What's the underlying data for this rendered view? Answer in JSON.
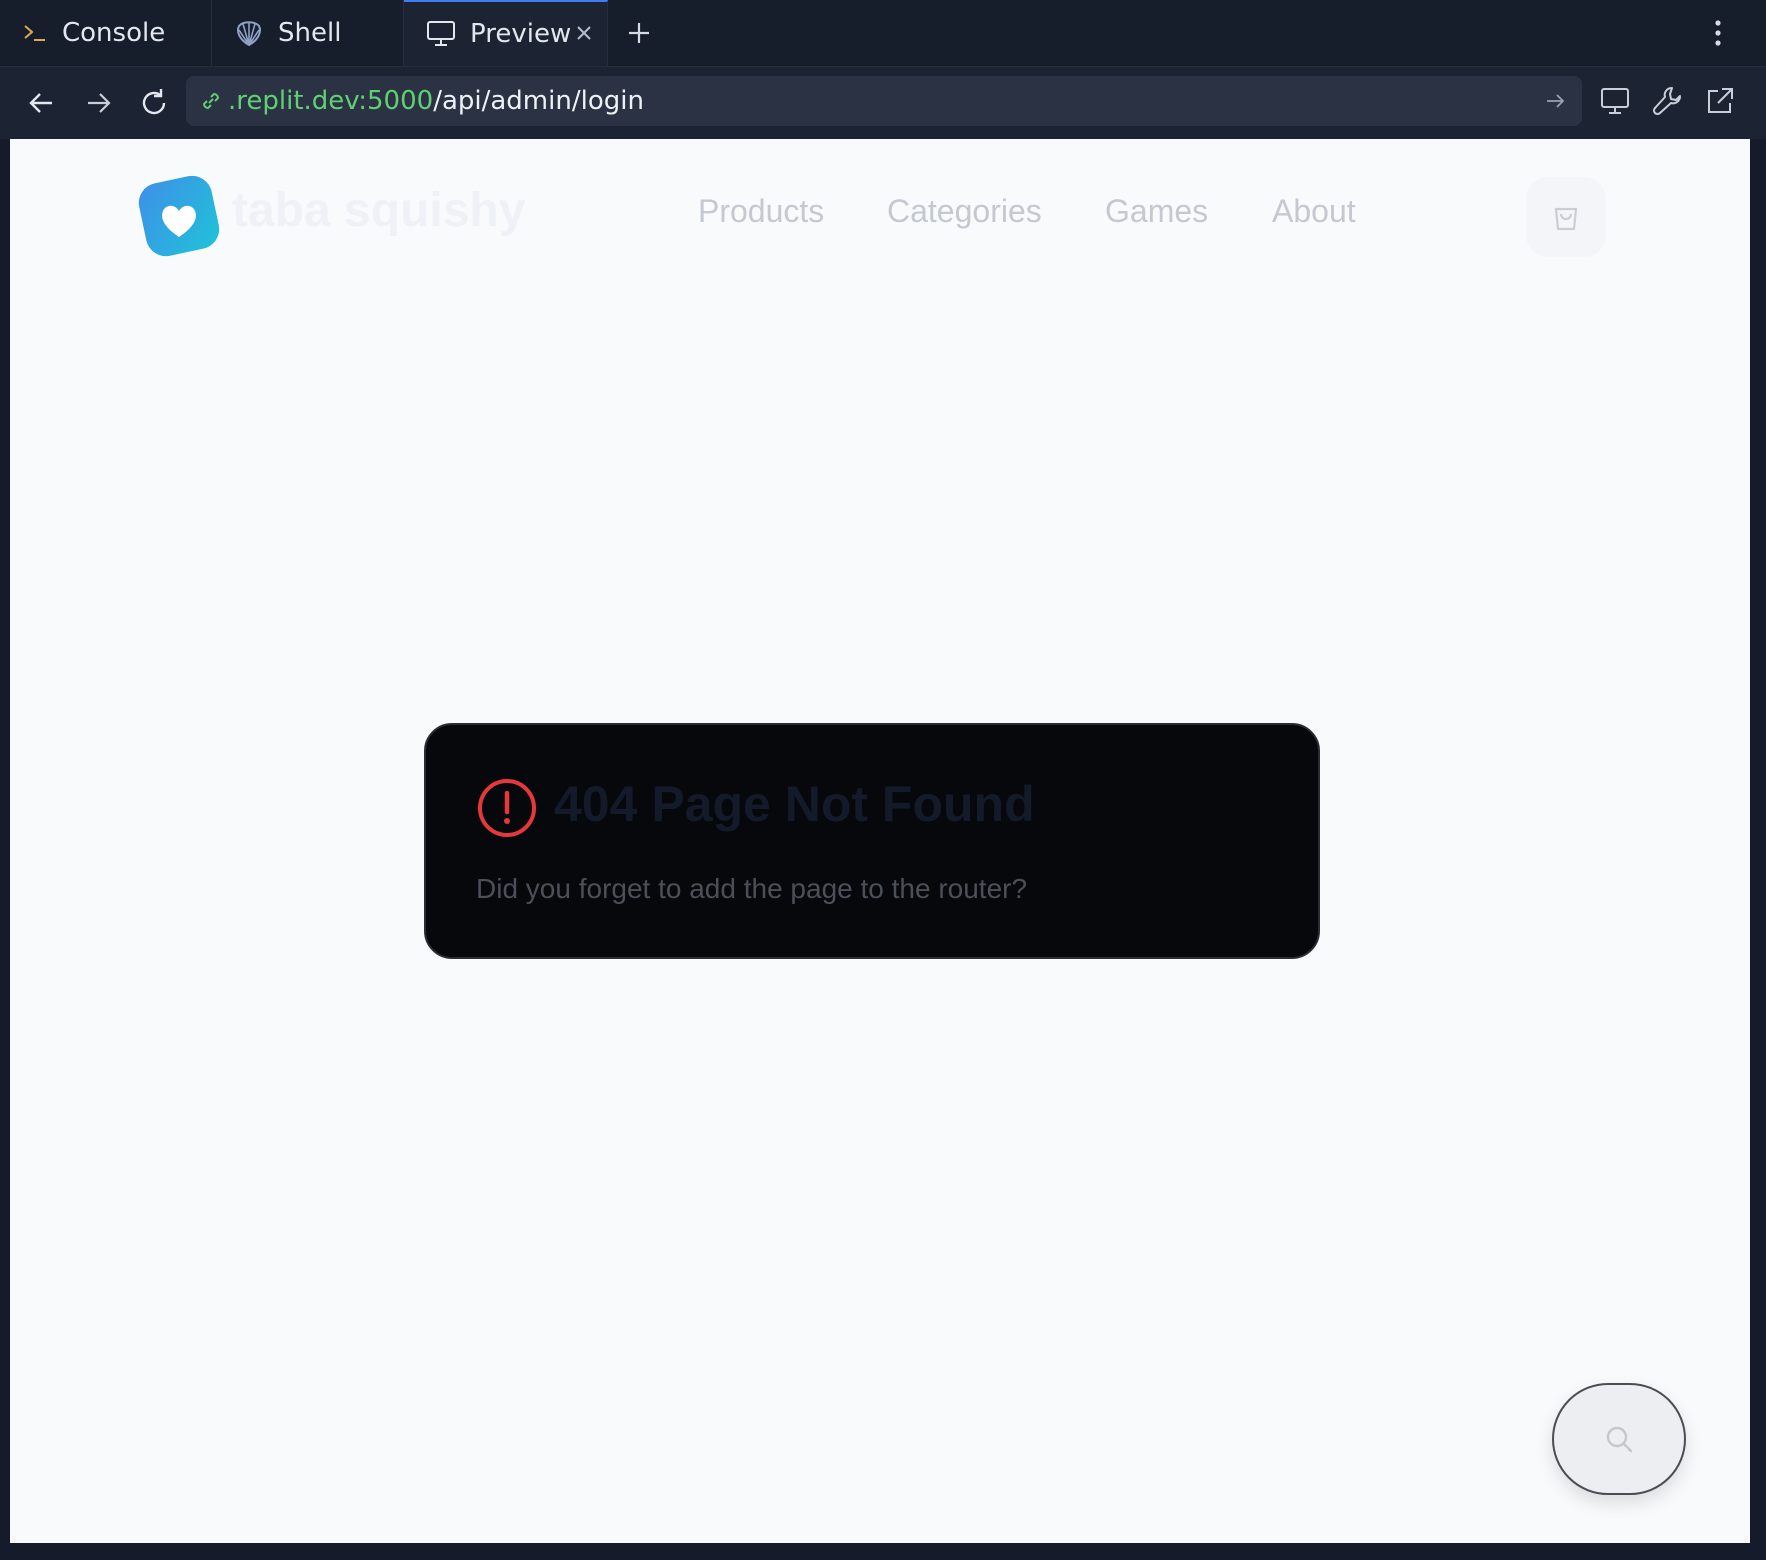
{
  "tabs": [
    {
      "label": "Console",
      "icon": "terminal-icon"
    },
    {
      "label": "Shell",
      "icon": "shell-icon"
    },
    {
      "label": "Preview",
      "icon": "monitor-icon",
      "active": true
    }
  ],
  "addressbar": {
    "host": ".replit.dev:5000",
    "path": "/api/admin/login"
  },
  "site": {
    "brand": "taba squishy",
    "nav": [
      "Products",
      "Categories",
      "Games",
      "About"
    ]
  },
  "error_card": {
    "title": "404 Page Not Found",
    "message": "Did you forget to add the page to the router?"
  },
  "colors": {
    "url_host": "#5fd073",
    "error_icon": "#e5383b",
    "active_tab_accent": "#3f7bf2",
    "logo_gradient_start": "#3aa7e8",
    "logo_gradient_end": "#1fc3d8"
  }
}
